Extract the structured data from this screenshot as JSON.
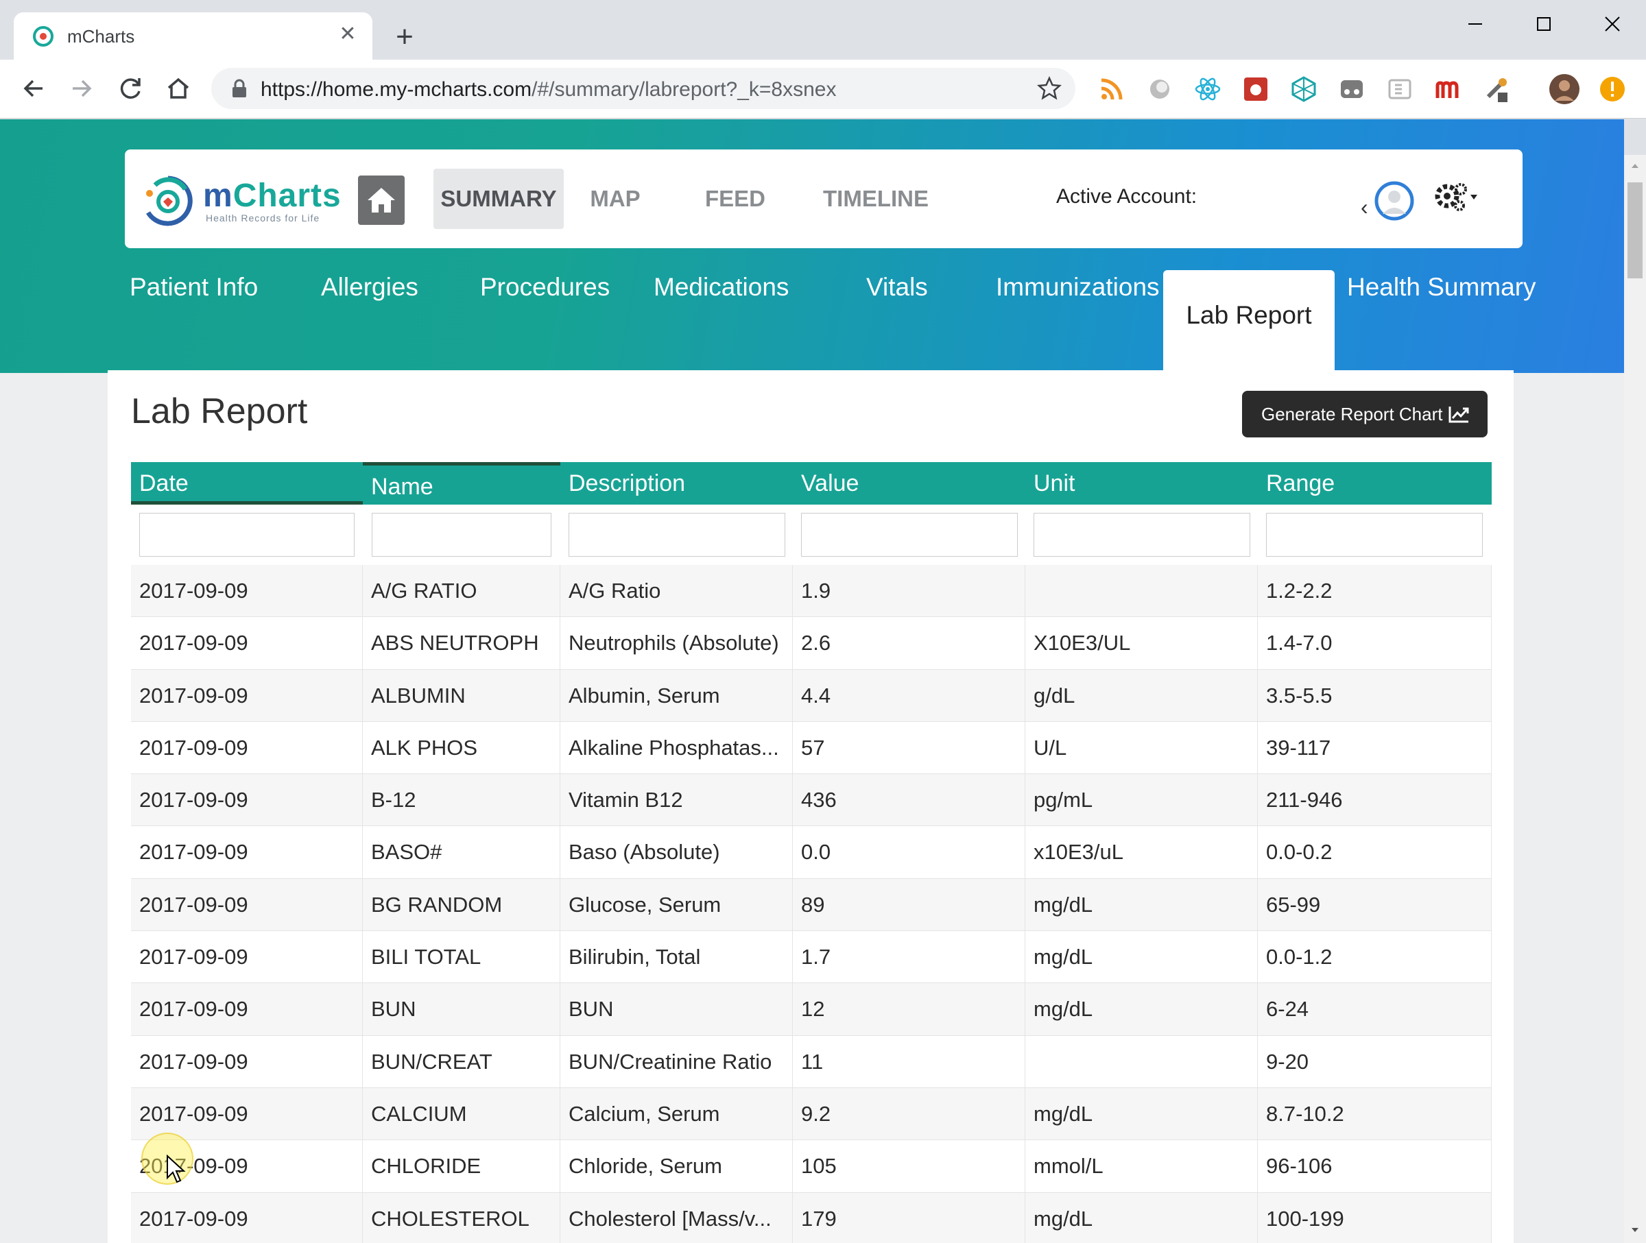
{
  "browser": {
    "tab_title": "mCharts",
    "url_host": "https://home.my-mcharts.com",
    "url_path": "/#/summary/labreport?_k=8xsnex"
  },
  "app": {
    "logo_name_part1": "m",
    "logo_name_part2": "Charts",
    "logo_tagline": "Health Records for Life",
    "nav": [
      {
        "label": "SUMMARY"
      },
      {
        "label": "MAP"
      },
      {
        "label": "FEED"
      },
      {
        "label": "TIMELINE"
      }
    ],
    "active_account_label": "Active Account:",
    "subnav": [
      {
        "label": "Patient Info"
      },
      {
        "label": "Allergies"
      },
      {
        "label": "Procedures"
      },
      {
        "label": "Medications"
      },
      {
        "label": "Vitals"
      },
      {
        "label": "Immunizations"
      },
      {
        "label": "Lab Report"
      },
      {
        "label": "Health Summary"
      }
    ]
  },
  "report": {
    "title": "Lab Report",
    "generate_button_label": "Generate Report Chart",
    "columns": [
      "Date",
      "Name",
      "Description",
      "Value",
      "Unit",
      "Range"
    ],
    "rows": [
      [
        "2017-09-09",
        "A/G RATIO",
        "A/G Ratio",
        "1.9",
        "",
        "1.2-2.2"
      ],
      [
        "2017-09-09",
        "ABS NEUTROPH",
        "Neutrophils (Absolute)",
        "2.6",
        "X10E3/UL",
        "1.4-7.0"
      ],
      [
        "2017-09-09",
        "ALBUMIN",
        "Albumin, Serum",
        "4.4",
        "g/dL",
        "3.5-5.5"
      ],
      [
        "2017-09-09",
        "ALK PHOS",
        "Alkaline Phosphatas...",
        "57",
        "U/L",
        "39-117"
      ],
      [
        "2017-09-09",
        "B-12",
        "Vitamin B12",
        "436",
        "pg/mL",
        "211-946"
      ],
      [
        "2017-09-09",
        "BASO#",
        "Baso (Absolute)",
        "0.0",
        "x10E3/uL",
        "0.0-0.2"
      ],
      [
        "2017-09-09",
        "BG RANDOM",
        "Glucose, Serum",
        "89",
        "mg/dL",
        "65-99"
      ],
      [
        "2017-09-09",
        "BILI TOTAL",
        "Bilirubin, Total",
        "1.7",
        "mg/dL",
        "0.0-1.2"
      ],
      [
        "2017-09-09",
        "BUN",
        "BUN",
        "12",
        "mg/dL",
        "6-24"
      ],
      [
        "2017-09-09",
        "BUN/CREAT",
        "BUN/Creatinine Ratio",
        "11",
        "",
        "9-20"
      ],
      [
        "2017-09-09",
        "CALCIUM",
        "Calcium, Serum",
        "9.2",
        "mg/dL",
        "8.7-10.2"
      ],
      [
        "2017-09-09",
        "CHLORIDE",
        "Chloride, Serum",
        "105",
        "mmol/L",
        "96-106"
      ],
      [
        "2017-09-09",
        "CHOLESTEROL",
        "Cholesterol [Mass/v...",
        "179",
        "mg/dL",
        "100-199"
      ]
    ]
  },
  "colors": {
    "header_teal": "#17a394",
    "banner_blue": "#2a7fe0",
    "button_dark": "#2b2b2b"
  }
}
